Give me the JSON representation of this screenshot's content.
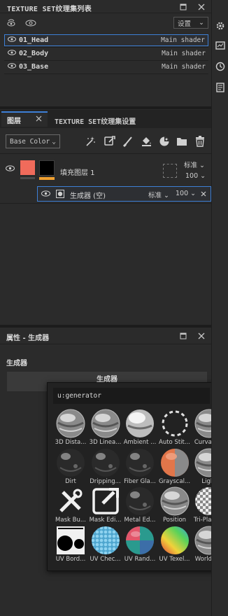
{
  "texture_set_list": {
    "title": "TEXTURE SET纹理集列表",
    "settings_label": "设置",
    "rows": [
      {
        "name": "01_Head",
        "shader": "Main shader"
      },
      {
        "name": "02_Body",
        "shader": "Main shader"
      },
      {
        "name": "03_Base",
        "shader": "Main shader"
      }
    ]
  },
  "layers_panel": {
    "tab_layers": "图层",
    "tab_settings": "TEXTURE SET纹理集设置",
    "channel_select": "Base Color",
    "fill_layer": {
      "name": "填充图层 1",
      "blend_mode": "标准",
      "opacity": "100"
    },
    "generator": {
      "name": "生成器 (空)",
      "blend_mode": "标准",
      "opacity": "100"
    }
  },
  "properties_panel": {
    "title": "属性 - 生成器",
    "section": "生成器",
    "button_label": "生成器"
  },
  "generator_picker": {
    "search_value": "u:generator",
    "items": [
      {
        "label": "3D Dista...",
        "style": "chrome"
      },
      {
        "label": "3D Linea...",
        "style": "chrome"
      },
      {
        "label": "Ambient ...",
        "style": "white"
      },
      {
        "label": "Auto Stit...",
        "style": "dashed"
      },
      {
        "label": "Curvature",
        "style": "chrome"
      },
      {
        "label": "Dirt",
        "style": "dark"
      },
      {
        "label": "Dripping...",
        "style": "dark"
      },
      {
        "label": "Fiber Gla...",
        "style": "dark"
      },
      {
        "label": "Grayscal...",
        "style": "orange"
      },
      {
        "label": "Light",
        "style": "chrome"
      },
      {
        "label": "Mask Bu...",
        "style": "tools"
      },
      {
        "label": "Mask Edi...",
        "style": "editor"
      },
      {
        "label": "Metal Ed...",
        "style": "dark"
      },
      {
        "label": "Position",
        "style": "chrome"
      },
      {
        "label": "Tri-Plana...",
        "style": "checker"
      },
      {
        "label": "UV Bord...",
        "style": "uvborder"
      },
      {
        "label": "UV Chec...",
        "style": "blue"
      },
      {
        "label": "UV Rand...",
        "style": "multi"
      },
      {
        "label": "UV Texel...",
        "style": "gradient"
      },
      {
        "label": "World S...",
        "style": "chrome"
      }
    ]
  },
  "colors": {
    "accent_blue": "#3d7fd6",
    "fill_thumb": "#f06b5b",
    "orange_bar": "#f0a030"
  }
}
